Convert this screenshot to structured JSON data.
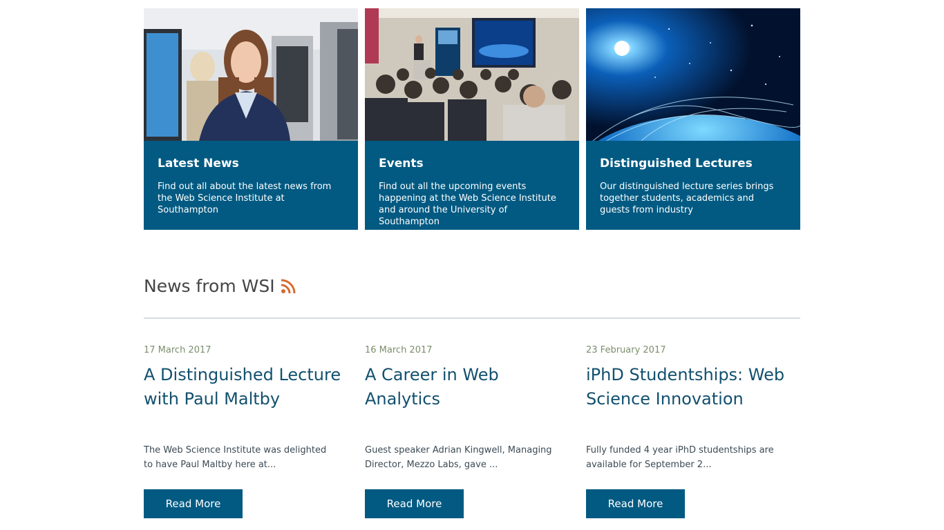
{
  "cards": [
    {
      "title": "Latest News",
      "text": "Find out all about the latest news from the Web Science Institute at Southampton",
      "image": "student-at-computer-photo"
    },
    {
      "title": "Events",
      "text": "Find out all the upcoming events happening at the Web Science Institute and around the University of Southampton",
      "image": "lecture-audience-photo"
    },
    {
      "title": "Distinguished Lectures",
      "text": "Our distinguished lecture series brings together students, academics and guests from industry",
      "image": "glowing-globe-network-photo"
    }
  ],
  "news_section": {
    "heading": "News from WSI",
    "feed_icon": "rss-icon",
    "items": [
      {
        "date": "17 March 2017",
        "headline": "A Distinguished Lecture with Paul Maltby",
        "excerpt": "The Web Science Institute was delighted to have Paul Maltby here at...",
        "button": "Read More"
      },
      {
        "date": "16 March 2017",
        "headline": "A Career in Web Analytics",
        "excerpt": "Guest speaker Adrian Kingwell, Managing Director, Mezzo Labs, gave ...",
        "button": "Read More"
      },
      {
        "date": "23 February 2017",
        "headline": "iPhD Studentships: Web Science Innovation",
        "excerpt": "Fully funded 4 year iPhD studentships are available for September 2...",
        "button": "Read More"
      }
    ]
  },
  "colors": {
    "brand": "#025a82",
    "headline": "#12506e",
    "date": "#7a8e6c",
    "rss": "#d86a30"
  }
}
